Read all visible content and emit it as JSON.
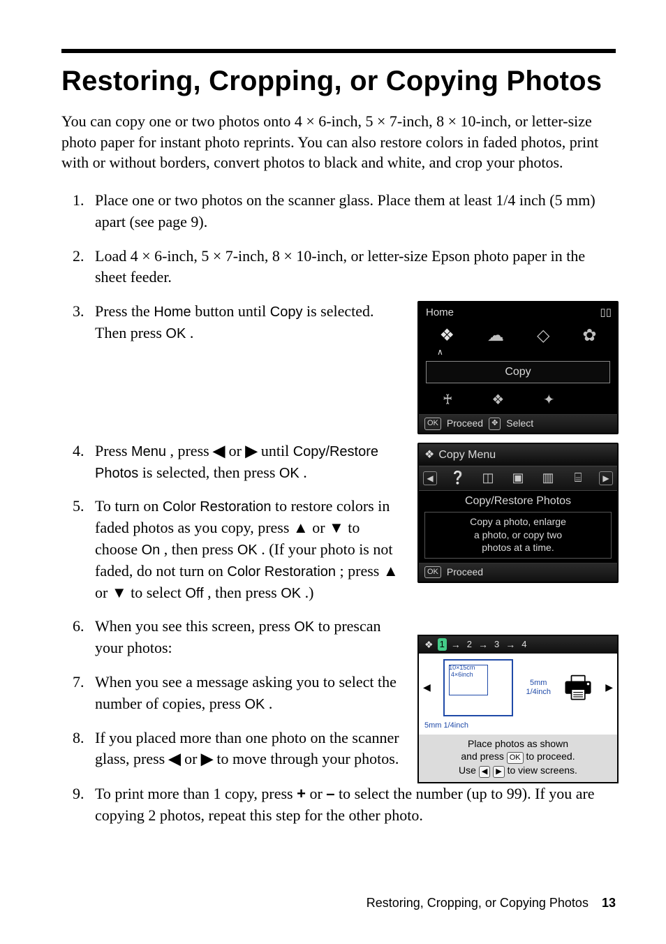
{
  "title": "Restoring, Cropping, or Copying Photos",
  "intro": "You can copy one or two photos onto 4 × 6-inch, 5 × 7-inch, 8 × 10-inch, or letter-size photo paper for instant photo reprints. You can also restore colors in faded photos, print with or without borders, convert photos to black and white, and crop your photos.",
  "steps": {
    "s1": "Place one or two photos on the scanner glass. Place them at least 1/4 inch (5 mm) apart (see page 9).",
    "s2": "Load 4 × 6-inch, 5 × 7-inch, 8 × 10-inch, or letter-size Epson photo paper in the sheet feeder.",
    "s3a": "Press the ",
    "s3b": " button until ",
    "s3c": " is selected. Then press ",
    "s3d": ".",
    "s4a": "Press ",
    "s4b": ", press ",
    "s4c": " or ",
    "s4d": " until ",
    "s4e": " is selected, then press ",
    "s4f": ".",
    "s5a": "To turn on ",
    "s5b": " to restore colors in faded photos as you copy, press ",
    "s5c": " or ",
    "s5d": " to choose ",
    "s5e": ", then press ",
    "s5f": ". (If your photo is not faded, do not turn on ",
    "s5g": "; press ",
    "s5h": " or ",
    "s5i": " to select ",
    "s5j": ", then press ",
    "s5k": ".)",
    "s6a": "When you see this screen, press ",
    "s6b": " to prescan your photos:",
    "s7a": "When you see a message asking you to select the number of copies, press ",
    "s7b": ".",
    "s8a": "If you placed more than one photo on the scanner glass, press ",
    "s8b": " or ",
    "s8c": " to move through your photos.",
    "s9a": "To print more than 1 copy, press ",
    "s9b": " or ",
    "s9c": " to select the number (up to 99). If you are copying 2 photos, repeat this step for the other photo."
  },
  "labels": {
    "home": "Home",
    "copy": "Copy",
    "ok": "OK",
    "menu": "Menu",
    "copy_restore": "Copy/Restore Photos",
    "color_restoration": "Color Restoration",
    "on": "On",
    "off": "Off",
    "plus": "+",
    "minus": "–",
    "left": "◀",
    "right": "▶",
    "up": "▲",
    "down": "▼"
  },
  "fig_home": {
    "top_left": "Home",
    "label": "Copy",
    "status_ok": "OK",
    "status_proceed": "Proceed",
    "status_select": "Select"
  },
  "fig_menu": {
    "header": "Copy Menu",
    "label": "Copy/Restore Photos",
    "desc1": "Copy a photo, enlarge",
    "desc2": "a photo, or copy two",
    "desc3": "photos at a time.",
    "status_ok": "OK",
    "status_proceed": "Proceed"
  },
  "fig_place": {
    "crumb": "1 → 2 → 3 → 4",
    "dim1": "10×15cm",
    "dim2": "4×6inch",
    "dim3": "5mm",
    "dim4": "1/4inch",
    "dim5": "5mm 1/4inch",
    "cap1": "Place photos as shown",
    "cap2a": "and press ",
    "cap2b": " to proceed.",
    "cap3a": "Use ",
    "cap3b": " to view screens.",
    "ok": "OK",
    "left": "◀",
    "right": "▶"
  },
  "footer": {
    "section": "Restoring, Cropping, or Copying Photos",
    "page": "13"
  }
}
